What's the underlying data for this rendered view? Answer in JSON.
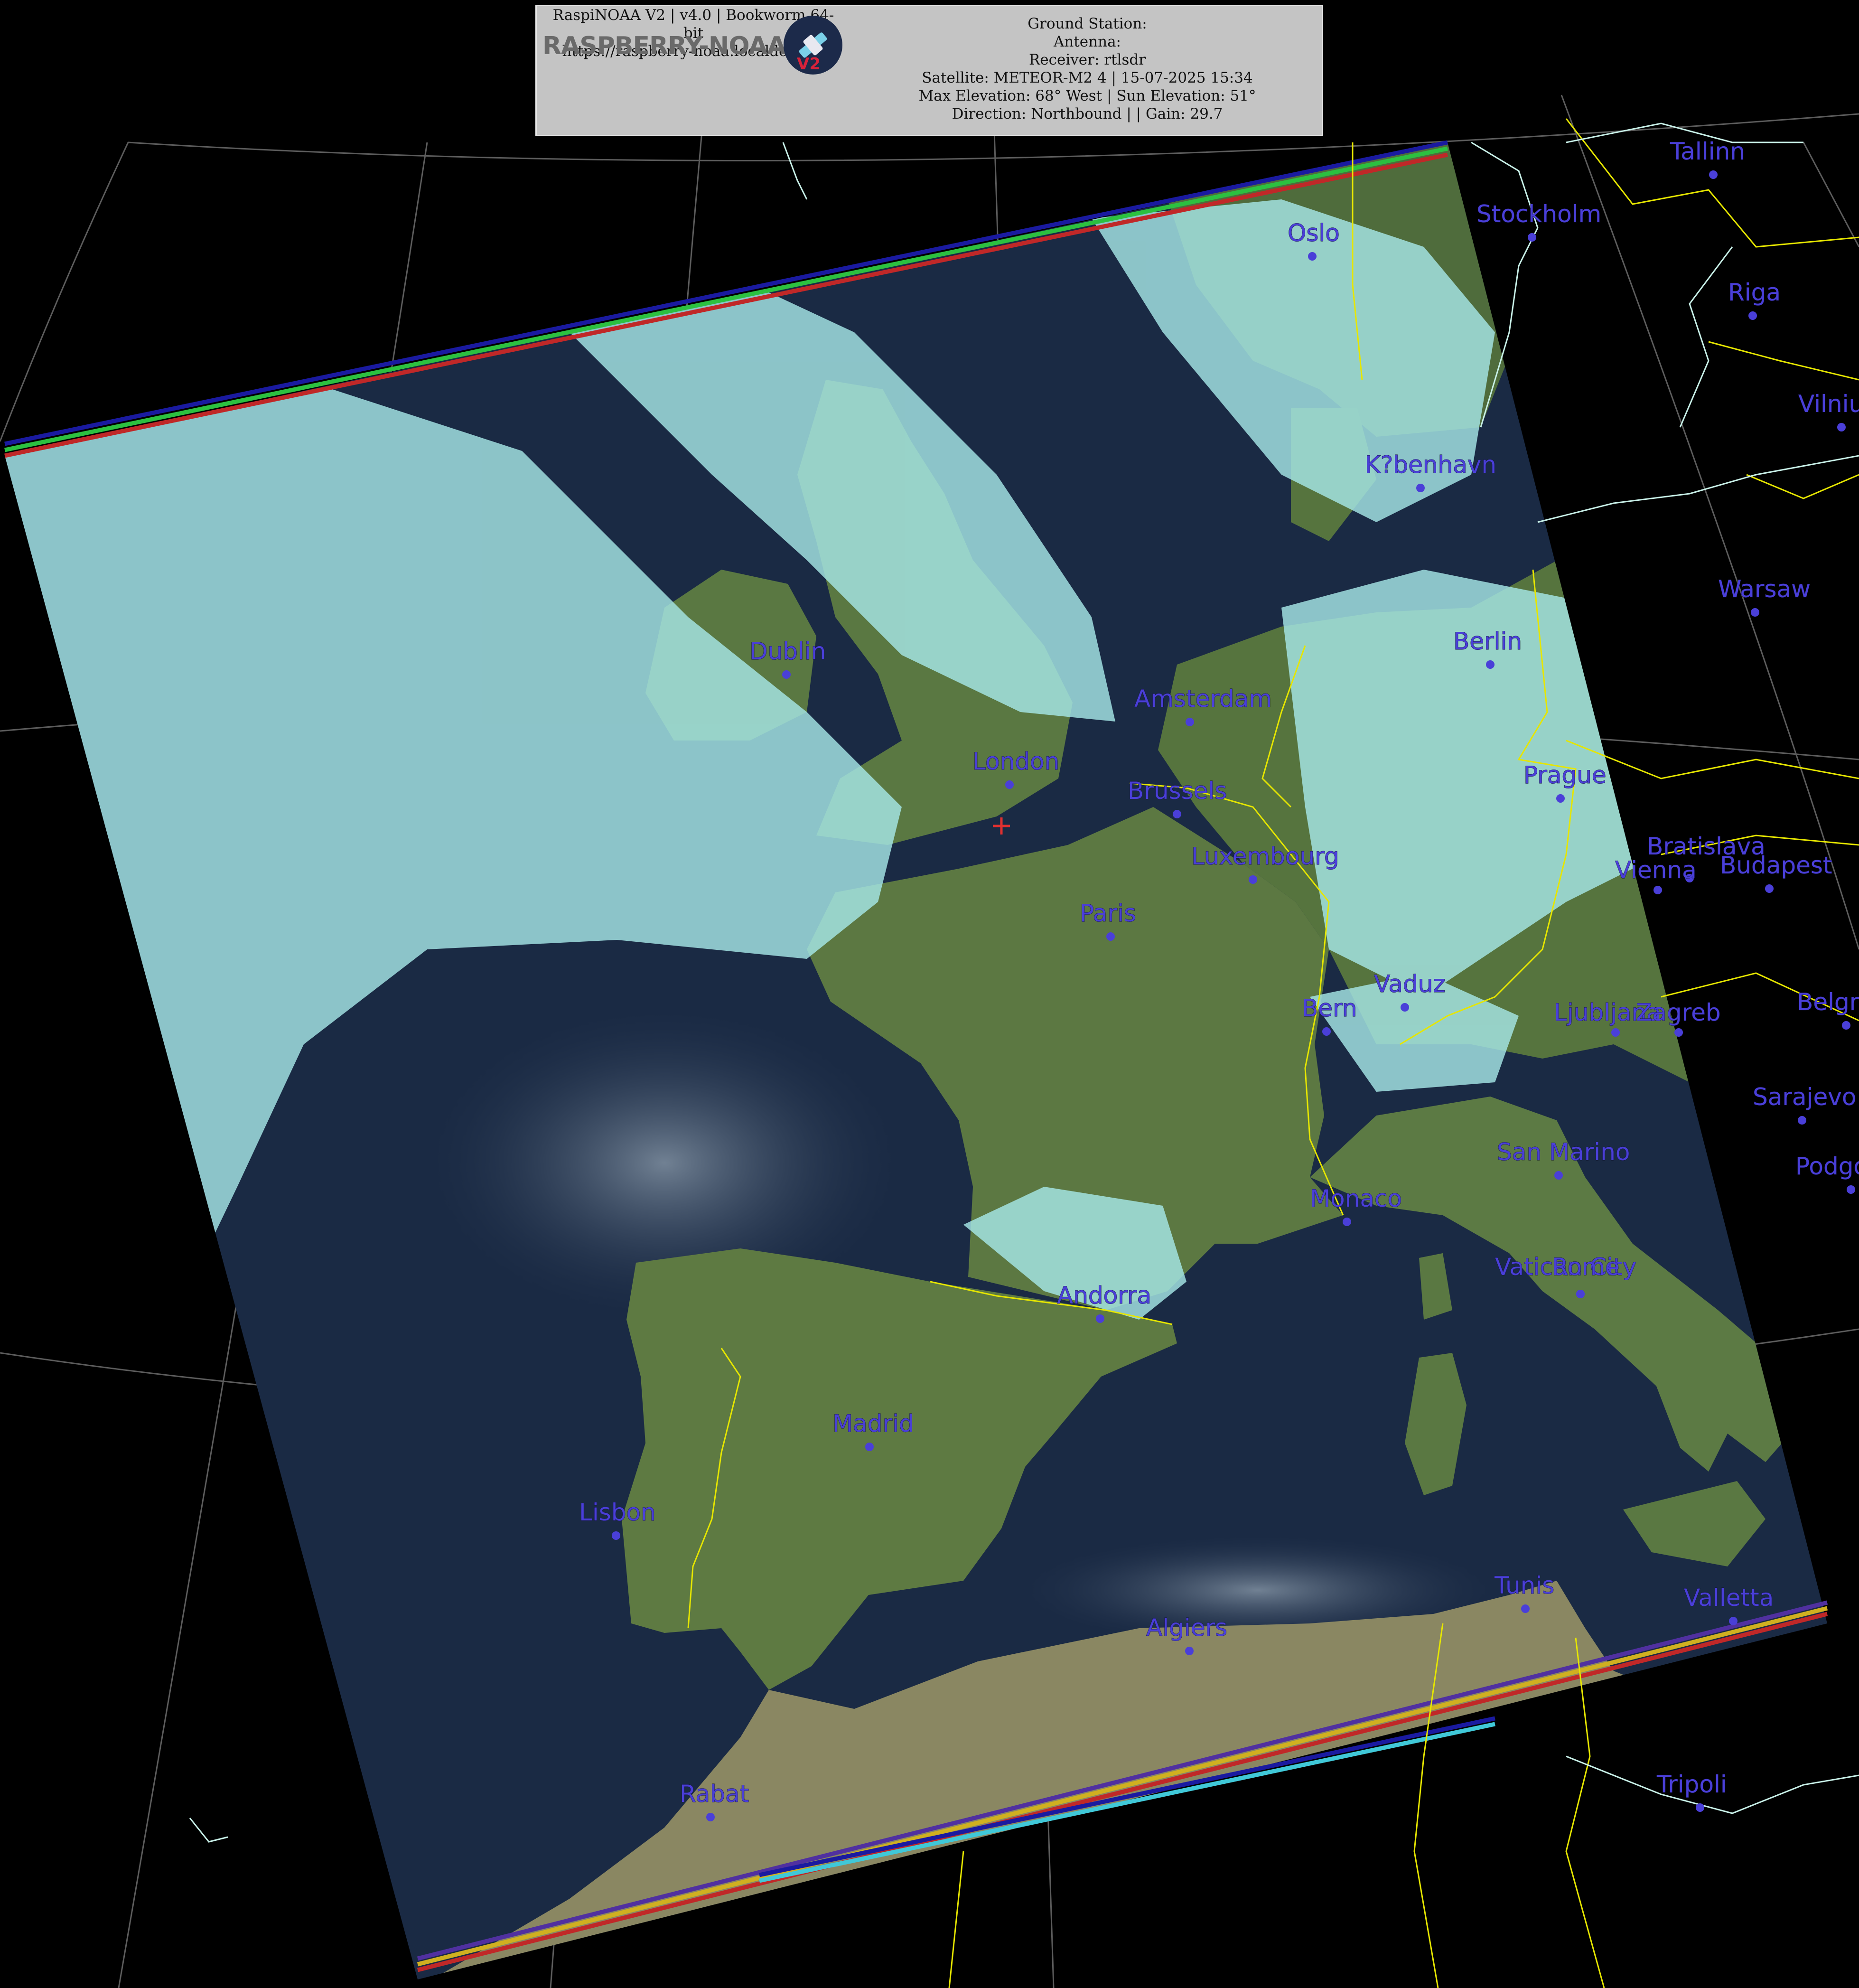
{
  "header": {
    "logo_text": "RASPBERRY-NOAA",
    "logo_version": "V2",
    "left_lines": [
      "RaspiNOAA V2 | v4.0 | Bookworm 64-",
      "bit",
      "https://raspberry-noaa.localdomain"
    ],
    "right_lines": [
      "Ground Station:",
      "Antenna:",
      "Receiver: rtlsdr",
      "Satellite: METEOR-M2 4 | 15-07-2025 15:34",
      "Max Elevation: 68° West | Sun Elevation: 51°",
      "Direction: Northbound | | Gain: 29.7"
    ]
  },
  "colors": {
    "city_label": "#4a3fd8",
    "country_border": "#e6e600",
    "coastline": "#c8f0e8",
    "graticule": "#9a9a9a",
    "ocean": "#1a2a44",
    "land": "#5d7a42",
    "cloud": "#a6e6e6",
    "station_marker": "#e03030"
  },
  "cities": [
    {
      "name": "Tallinn"
    },
    {
      "name": "Stockholm"
    },
    {
      "name": "Oslo"
    },
    {
      "name": "Riga"
    },
    {
      "name": "Vilnius"
    },
    {
      "name": "K?benhavn"
    },
    {
      "name": "Warsaw"
    },
    {
      "name": "Berlin"
    },
    {
      "name": "Dublin"
    },
    {
      "name": "Amsterdam"
    },
    {
      "name": "London"
    },
    {
      "name": "Brussels"
    },
    {
      "name": "Prague"
    },
    {
      "name": "Luxembourg"
    },
    {
      "name": "Bratislava"
    },
    {
      "name": "Vienna"
    },
    {
      "name": "Budapest"
    },
    {
      "name": "Paris"
    },
    {
      "name": "Vaduz"
    },
    {
      "name": "Bern"
    },
    {
      "name": "Ljubljana"
    },
    {
      "name": "Zagreb"
    },
    {
      "name": "Belgrade"
    },
    {
      "name": "Sarajevo"
    },
    {
      "name": "San Marino"
    },
    {
      "name": "Podgorica"
    },
    {
      "name": "Monaco"
    },
    {
      "name": "Vatican City"
    },
    {
      "name": "Rome"
    },
    {
      "name": "Andorra"
    },
    {
      "name": "Madrid"
    },
    {
      "name": "Lisbon"
    },
    {
      "name": "Tunis"
    },
    {
      "name": "Valletta"
    },
    {
      "name": "Algiers"
    },
    {
      "name": "Rabat"
    },
    {
      "name": "Tripoli"
    }
  ]
}
